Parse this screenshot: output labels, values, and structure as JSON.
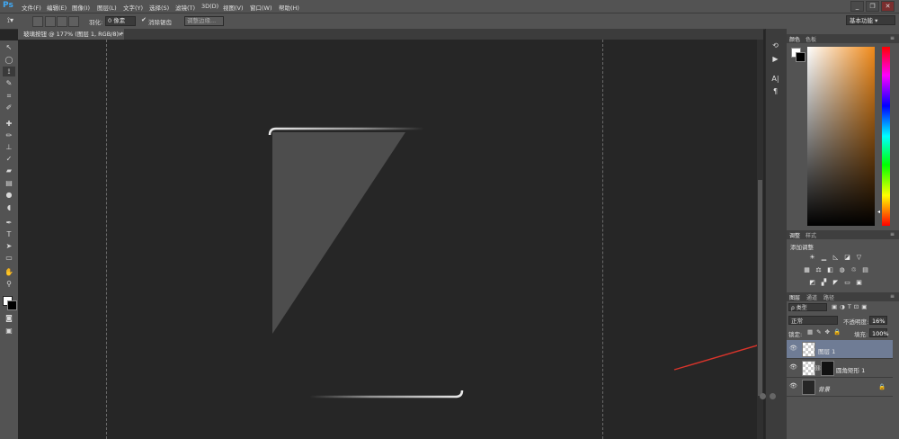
{
  "app": {
    "logo": "Ps"
  },
  "menu": [
    "文件(F)",
    "编辑(E)",
    "图像(I)",
    "图层(L)",
    "文字(Y)",
    "选择(S)",
    "滤镜(T)",
    "3D(D)",
    "视图(V)",
    "窗口(W)",
    "帮助(H)"
  ],
  "window_controls": [
    "_",
    "❐",
    "✕"
  ],
  "options_bar": {
    "feather_label": "羽化:",
    "feather_value": "0 像素",
    "antialias_label": "消除锯齿",
    "refine_edge_label": "调整边缘..."
  },
  "workspace": {
    "label": "基本功能"
  },
  "document_tab": {
    "title": "玻璃按钮 @ 177% (图层 1, RGB/8) *",
    "close": "×"
  },
  "color_panel": {
    "tabs": [
      "颜色",
      "色板"
    ],
    "hue_accent": "#f08a1a"
  },
  "adjustments_panel": {
    "tabs": [
      "调整",
      "样式"
    ],
    "title": "添加调整"
  },
  "layers_panel": {
    "tabs": [
      "图层",
      "通道",
      "路径"
    ],
    "filter_label": "ρ 类型",
    "blend_mode": "正常",
    "opacity_label": "不透明度:",
    "opacity_value": "16%",
    "lock_label": "锁定:",
    "fill_label": "填充:",
    "fill_value": "100%",
    "layers": [
      {
        "name": "图层 1",
        "selected": true
      },
      {
        "name": "圆角矩形 1",
        "selected": false
      },
      {
        "name": "背景",
        "selected": false
      }
    ]
  },
  "annotation": {
    "arrow_color": "#d9342b"
  }
}
